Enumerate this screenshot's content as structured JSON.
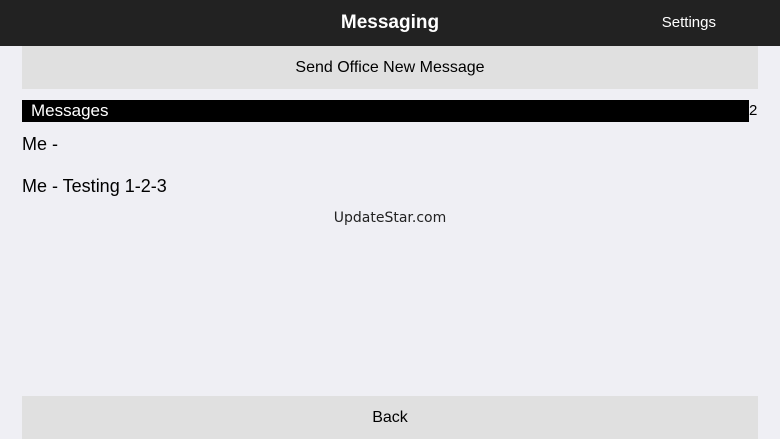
{
  "navbar": {
    "title": "Messaging",
    "settings_label": "Settings",
    "background": "#222222"
  },
  "send_button": {
    "label": "Send Office New Message"
  },
  "messages_section": {
    "title": "Messages",
    "count": "2",
    "items": [
      {
        "label": "Me - "
      },
      {
        "label": "Me - Testing 1-2-3"
      }
    ]
  },
  "watermark": "UpdateStar.com",
  "back_button": {
    "label": "Back"
  }
}
